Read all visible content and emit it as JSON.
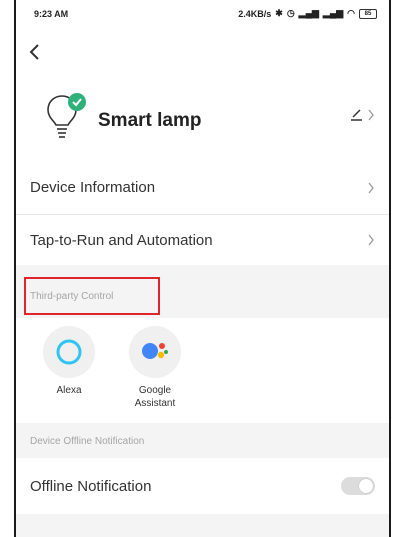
{
  "status_bar": {
    "time": "9:23 AM",
    "network_speed": "2.4KB/s",
    "battery": "85"
  },
  "header": {
    "back_icon": "chevron-left-icon"
  },
  "device": {
    "name": "Smart lamp",
    "icon": "lightbulb-icon",
    "status_badge_icon": "check-icon",
    "edit_icon": "pencil-icon"
  },
  "menu": {
    "items": [
      {
        "label": "Device Information"
      },
      {
        "label": "Tap-to-Run and Automation"
      }
    ]
  },
  "third_party": {
    "section_title": "Third-party Control",
    "services": [
      {
        "name": "Alexa",
        "icon": "alexa-icon"
      },
      {
        "name": "Google Assistant",
        "icon": "google-assistant-icon"
      }
    ]
  },
  "offline": {
    "section_title": "Device Offline Notification",
    "label": "Offline Notification",
    "enabled": false
  },
  "colors": {
    "highlight": "#e0242b",
    "badge": "#2fb27a",
    "alexa": "#31c4f3",
    "google_blue": "#4285f4",
    "google_red": "#ea4335",
    "google_yellow": "#fbbc05",
    "google_green": "#34a853"
  }
}
